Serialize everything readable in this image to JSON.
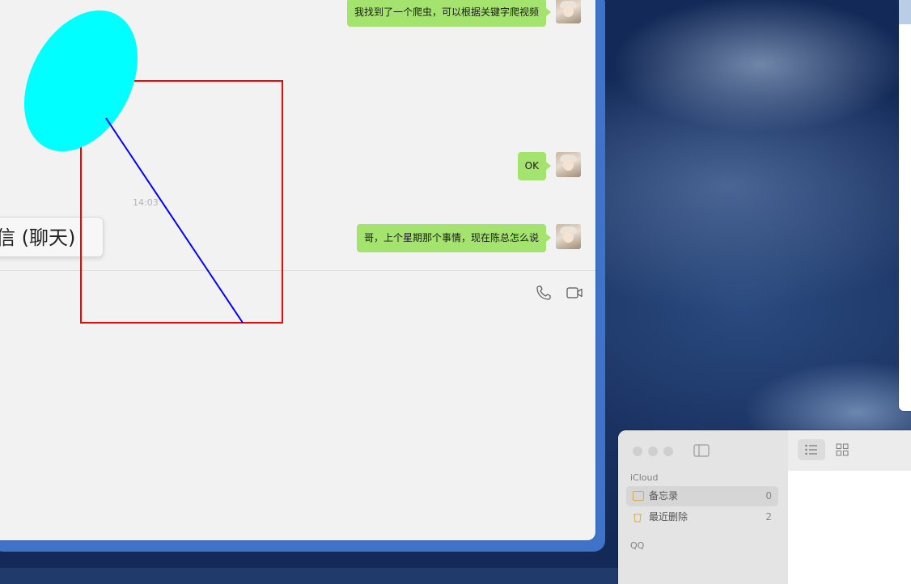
{
  "chat": {
    "messages": [
      {
        "text": "我找到了一个爬虫，可以根据关键字爬视频"
      },
      {
        "text": "OK"
      },
      {
        "text": "哥，上个星期那个事情，现在陈总怎么说"
      }
    ],
    "timestamp": "14:03",
    "tooltip": "微信 (聊天)"
  },
  "toolbar": {
    "icons": [
      "phone-icon",
      "video-call-icon"
    ]
  },
  "notes": {
    "section_icloud": "iCloud",
    "folders": [
      {
        "label": "备忘录",
        "count": "0"
      },
      {
        "label": "最近删除",
        "count": "2"
      }
    ],
    "section_qq": "QQ",
    "view_buttons": [
      "list-view-icon",
      "gallery-view-icon"
    ]
  },
  "colors": {
    "bubble": "#a4e46e",
    "window_frame": "#3e73c9",
    "annotation_ellipse": "#00ffff",
    "annotation_rect": "#ff0000",
    "annotation_line": "#0000ff"
  }
}
